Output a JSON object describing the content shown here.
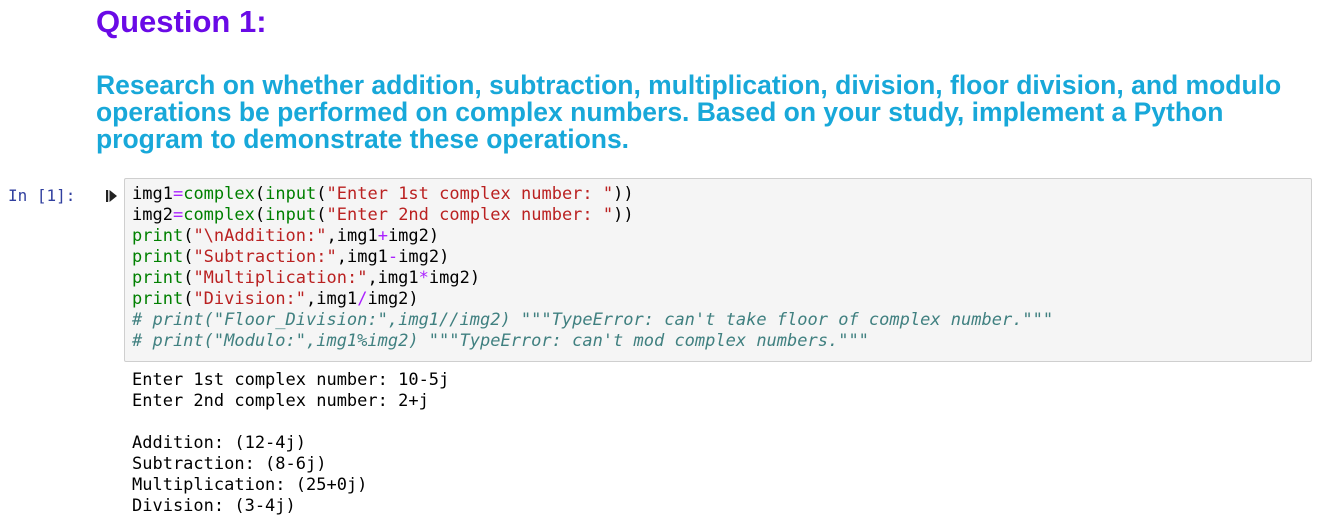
{
  "markdown": {
    "heading": "Question 1:",
    "question": "Research on whether addition, subtraction, multiplication, division, floor division, and modulo operations be performed on complex numbers. Based on your study, implement a Python program to demonstrate these operations."
  },
  "cell": {
    "prompt": "In [1]:",
    "run_icon": "run-step-icon",
    "code_lines": [
      [
        {
          "t": "p",
          "v": "img1"
        },
        {
          "t": "o",
          "v": "="
        },
        {
          "t": "b",
          "v": "complex"
        },
        {
          "t": "p",
          "v": "("
        },
        {
          "t": "b",
          "v": "input"
        },
        {
          "t": "p",
          "v": "("
        },
        {
          "t": "s",
          "v": "\"Enter 1st complex number: \""
        },
        {
          "t": "p",
          "v": "))"
        }
      ],
      [
        {
          "t": "p",
          "v": "img2"
        },
        {
          "t": "o",
          "v": "="
        },
        {
          "t": "b",
          "v": "complex"
        },
        {
          "t": "p",
          "v": "("
        },
        {
          "t": "b",
          "v": "input"
        },
        {
          "t": "p",
          "v": "("
        },
        {
          "t": "s",
          "v": "\"Enter 2nd complex number: \""
        },
        {
          "t": "p",
          "v": "))"
        }
      ],
      [
        {
          "t": "b",
          "v": "print"
        },
        {
          "t": "p",
          "v": "("
        },
        {
          "t": "s",
          "v": "\"\\nAddition:\""
        },
        {
          "t": "p",
          "v": ",img1"
        },
        {
          "t": "o",
          "v": "+"
        },
        {
          "t": "p",
          "v": "img2)"
        }
      ],
      [
        {
          "t": "b",
          "v": "print"
        },
        {
          "t": "p",
          "v": "("
        },
        {
          "t": "s",
          "v": "\"Subtraction:\""
        },
        {
          "t": "p",
          "v": ",img1"
        },
        {
          "t": "o",
          "v": "-"
        },
        {
          "t": "p",
          "v": "img2)"
        }
      ],
      [
        {
          "t": "b",
          "v": "print"
        },
        {
          "t": "p",
          "v": "("
        },
        {
          "t": "s",
          "v": "\"Multiplication:\""
        },
        {
          "t": "p",
          "v": ",img1"
        },
        {
          "t": "o",
          "v": "*"
        },
        {
          "t": "p",
          "v": "img2)"
        }
      ],
      [
        {
          "t": "b",
          "v": "print"
        },
        {
          "t": "p",
          "v": "("
        },
        {
          "t": "s",
          "v": "\"Division:\""
        },
        {
          "t": "p",
          "v": ",img1"
        },
        {
          "t": "o",
          "v": "/"
        },
        {
          "t": "p",
          "v": "img2)"
        }
      ],
      [
        {
          "t": "c",
          "v": "# print(\"Floor_Division:\",img1//img2) \"\"\"TypeError: can't take floor of complex number.\"\"\""
        }
      ],
      [
        {
          "t": "c",
          "v": "# print(\"Modulo:\",img1%img2) \"\"\"TypeError: can't mod complex numbers.\"\"\""
        }
      ]
    ],
    "output_lines": [
      "Enter 1st complex number: 10-5j",
      "Enter 2nd complex number: 2+j",
      "",
      "Addition: (12-4j)",
      "Subtraction: (8-6j)",
      "Multiplication: (25+0j)",
      "Division: (3-4j)"
    ]
  },
  "colors": {
    "heading": "#6a0ae6",
    "question": "#18a8d9",
    "prompt": "#303f9f",
    "builtin": "#008000",
    "string": "#ba2121",
    "operator": "#aa22ff",
    "comment": "#408080",
    "code_bg": "#f5f5f5"
  }
}
